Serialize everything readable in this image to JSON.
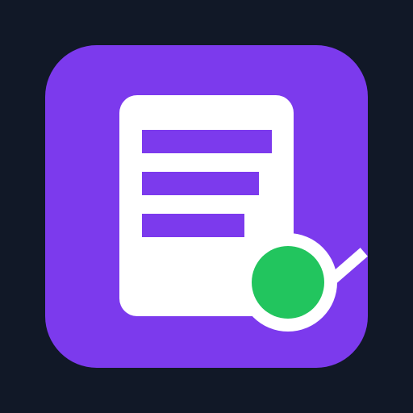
{
  "app_icon": {
    "icon_name": "document-search-icon",
    "elements": {
      "background_tile": "rounded-square",
      "document": "document-icon",
      "text_lines": [
        "line-1",
        "line-2",
        "line-3"
      ],
      "magnifier": "magnifying-glass-icon"
    },
    "colors": {
      "page_background": "#111827",
      "tile": "#7c3aed",
      "document": "#ffffff",
      "text_line": "#7c3aed",
      "lens_fill": "#22c55e",
      "lens_ring": "#ffffff",
      "handle": "#ffffff"
    }
  }
}
